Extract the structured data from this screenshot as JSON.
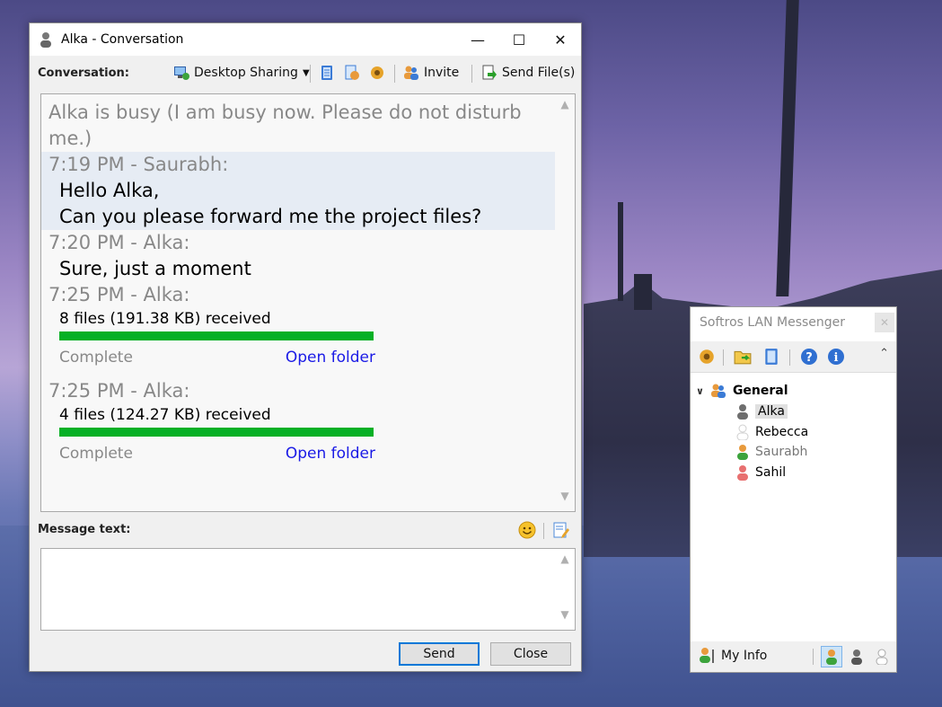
{
  "conversation_window": {
    "title": "Alka - Conversation",
    "toolbar": {
      "label": "Conversation:",
      "desktop_sharing": "Desktop Sharing",
      "invite": "Invite",
      "send_files": "Send File(s)"
    },
    "status": "Alka is busy (I am busy now. Please do not disturb me.)",
    "messages": [
      {
        "header": "7:19 PM - Saurabh:",
        "lines": [
          "Hello Alka,",
          "Can you please forward me the project files?"
        ]
      },
      {
        "header": "7:20 PM - Alka:",
        "lines": [
          "Sure, just a moment"
        ]
      }
    ],
    "transfers": [
      {
        "header": "7:25 PM - Alka:",
        "summary": "8 files (191.38 KB) received",
        "status": "Complete",
        "action": "Open folder",
        "progress_pct": 100
      },
      {
        "header": "7:25 PM - Alka:",
        "summary": "4 files (124.27 KB) received",
        "status": "Complete",
        "action": "Open folder",
        "progress_pct": 100
      }
    ],
    "message_label": "Message text:",
    "input_value": "",
    "buttons": {
      "send": "Send",
      "close": "Close"
    }
  },
  "messenger": {
    "title": "Softros LAN Messenger",
    "group": "General",
    "users": [
      {
        "name": "Alka",
        "status_color": "#6e6e6e"
      },
      {
        "name": "Rebecca",
        "status_color": "#cfcfcf"
      },
      {
        "name": "Saurabh",
        "status_color": "#e89a3c"
      },
      {
        "name": "Sahil",
        "status_color": "#e87070"
      }
    ],
    "my_info": "My Info"
  },
  "colors": {
    "progress": "#06b025",
    "link": "#1a1ae6",
    "accent": "#0078d7"
  }
}
